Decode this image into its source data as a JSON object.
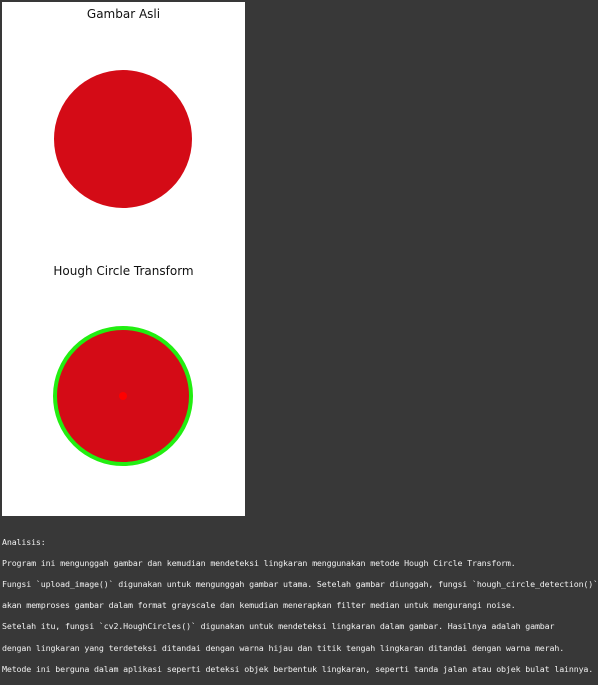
{
  "figure": {
    "panels": [
      {
        "title": "Gambar Asli",
        "circle_color": "#d40b16",
        "detected": false
      },
      {
        "title": "Hough Circle Transform",
        "circle_color": "#d40b16",
        "outline_color": "#22ee11",
        "center_color": "#ff0000",
        "detected": true
      }
    ]
  },
  "output": {
    "lines": [
      "Analisis:",
      "Program ini mengunggah gambar dan kemudian mendeteksi lingkaran menggunakan metode Hough Circle Transform.",
      "Fungsi `upload_image()` digunakan untuk mengunggah gambar utama. Setelah gambar diunggah, fungsi `hough_circle_detection()`",
      "akan memproses gambar dalam format grayscale dan kemudian menerapkan filter median untuk mengurangi noise.",
      "Setelah itu, fungsi `cv2.HoughCircles()` digunakan untuk mendeteksi lingkaran dalam gambar. Hasilnya adalah gambar",
      "dengan lingkaran yang terdeteksi ditandai dengan warna hijau dan titik tengah lingkaran ditandai dengan warna merah.",
      "Metode ini berguna dalam aplikasi seperti deteksi objek berbentuk lingkaran, seperti tanda jalan atau objek bulat lainnya."
    ]
  }
}
